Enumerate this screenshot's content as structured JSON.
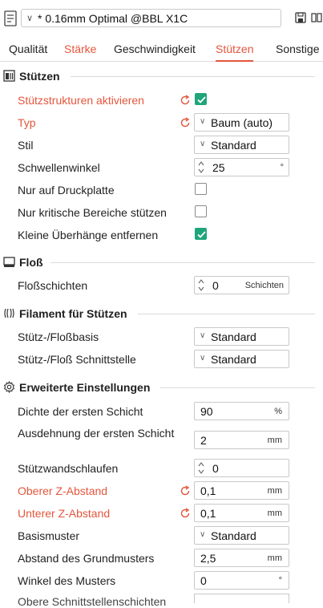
{
  "preset": {
    "name": "* 0.16mm Optimal @BBL X1C"
  },
  "tabs": [
    {
      "label": "Qualität"
    },
    {
      "label": "Stärke"
    },
    {
      "label": "Geschwindigkeit"
    },
    {
      "label": "Stützen"
    },
    {
      "label": "Sonstige"
    }
  ],
  "colors": {
    "accent": "#e5553c",
    "checked": "#1fa57a"
  },
  "sections": {
    "stuetzen": {
      "title": "Stützen",
      "rows": [
        {
          "label": "Stützstrukturen aktivieren",
          "checked": true
        },
        {
          "label": "Typ",
          "value": "Baum (auto)"
        },
        {
          "label": "Stil",
          "value": "Standard"
        },
        {
          "label": "Schwellenwinkel",
          "value": "25",
          "unit": "°"
        },
        {
          "label": "Nur auf Druckplatte",
          "checked": false
        },
        {
          "label": "Nur kritische Bereiche stützen",
          "checked": false
        },
        {
          "label": "Kleine Überhänge entfernen",
          "checked": true
        }
      ]
    },
    "floss": {
      "title": "Floß",
      "rows": [
        {
          "label": "Floßschichten",
          "value": "0",
          "unit": "Schichten"
        }
      ]
    },
    "filament": {
      "title": "Filament für Stützen",
      "rows": [
        {
          "label": "Stütz-/Floßbasis",
          "value": "Standard"
        },
        {
          "label": "Stütz-/Floß Schnittstelle",
          "value": "Standard"
        }
      ]
    },
    "erweitert": {
      "title": "Erweiterte Einstellungen",
      "rows": [
        {
          "label": "Dichte der ersten Schicht",
          "value": "90",
          "unit": "%"
        },
        {
          "label": "Ausdehnung der ersten Schicht",
          "value": "2",
          "unit": "mm"
        },
        {
          "label": "Stützwandschlaufen",
          "value": "0"
        },
        {
          "label": "Oberer Z-Abstand",
          "value": "0,1",
          "unit": "mm"
        },
        {
          "label": "Unterer Z-Abstand",
          "value": "0,1",
          "unit": "mm"
        },
        {
          "label": "Basismuster",
          "value": "Standard"
        },
        {
          "label": "Abstand des Grundmusters",
          "value": "2,5",
          "unit": "mm"
        },
        {
          "label": "Winkel des Musters",
          "value": "0",
          "unit": "°"
        },
        {
          "label": "Obere Schnittstellenschichten"
        }
      ]
    }
  }
}
